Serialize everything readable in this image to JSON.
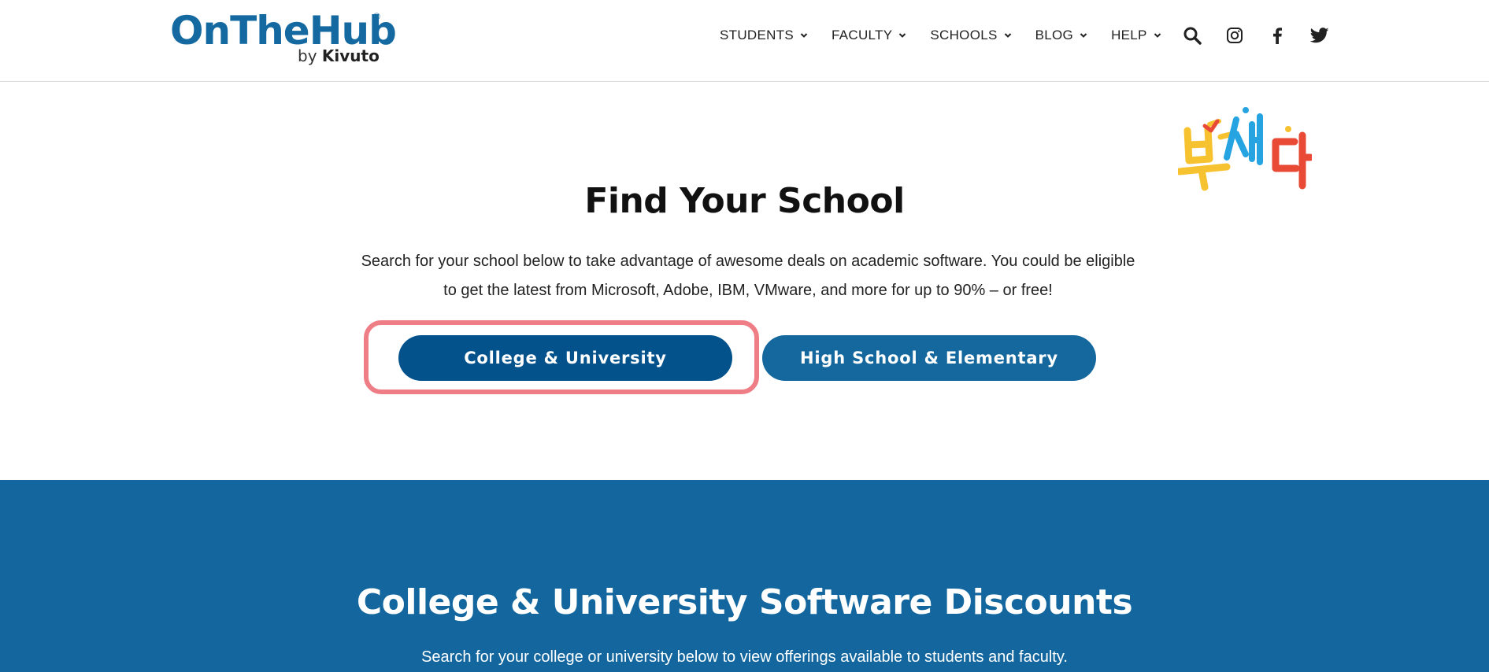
{
  "header": {
    "logo": {
      "main": "OnTheHub",
      "registered": "®",
      "by": "by",
      "brand": "Kivuto"
    },
    "nav": [
      {
        "label": "STUDENTS"
      },
      {
        "label": "FACULTY"
      },
      {
        "label": "SCHOOLS"
      },
      {
        "label": "BLOG"
      },
      {
        "label": "HELP"
      }
    ],
    "icons": [
      "search-icon",
      "instagram-icon",
      "facebook-icon",
      "twitter-icon"
    ]
  },
  "decoration": {
    "text": "빠세다"
  },
  "hero": {
    "title": "Find Your School",
    "description": "Search for your school below to take advantage of awesome deals on academic software. You could be eligible to get the latest from Microsoft, Adobe, IBM, VMware, and more for up to 90% – or free!",
    "buttons": {
      "college": "College & University",
      "highschool": "High School & Elementary"
    }
  },
  "band": {
    "title": "College & University Software Discounts",
    "description": "Search for your college or university below to view offerings available to students and faculty."
  },
  "colors": {
    "brand": "#1469a0",
    "button_primary": "#04528c",
    "button_secondary": "#14689e",
    "band": "#13679e",
    "highlight": "#ef7d86"
  }
}
